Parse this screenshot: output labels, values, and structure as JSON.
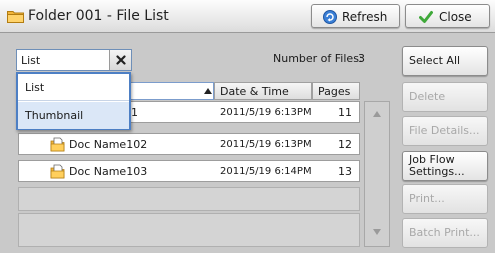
{
  "window": {
    "title": "Folder 001 - File List"
  },
  "toolbar": {
    "refresh_label": "Refresh",
    "close_label": "Close"
  },
  "view_select": {
    "selected": "List",
    "options": [
      "List",
      "Thumbnail"
    ]
  },
  "file_count": {
    "label": "Number of Files:",
    "value": "3"
  },
  "table": {
    "columns": [
      "Date & Time",
      "Pages"
    ],
    "rows": [
      {
        "name": "1",
        "date": "2011/5/19 6:13PM",
        "pages": "11"
      },
      {
        "name": "Doc Name102",
        "date": "2011/5/19 6:13PM",
        "pages": "12"
      },
      {
        "name": "Doc Name103",
        "date": "2011/5/19 6:14PM",
        "pages": "13"
      }
    ]
  },
  "actions": {
    "select_all": "Select All",
    "delete": "Delete",
    "file_details": "File Details...",
    "job_flow_line1": "Job Flow",
    "job_flow_line2": "Settings...",
    "print": "Print...",
    "batch_print": "Batch Print..."
  },
  "colors": {
    "title_bar": "#e9e9e9",
    "panel_background": "#c9c9c9",
    "dropdown_border": "#4d7fc4",
    "dropdown_highlight": "#dbe7f7",
    "disabled_text": "#a8a8a8"
  },
  "icons": {
    "folder": "folder-icon",
    "refresh": "refresh-icon",
    "close": "checkmark-icon",
    "clear": "close-x-icon",
    "document": "document-icon",
    "sort": "sort-up-icon",
    "scroll_up": "scroll-up-icon",
    "scroll_down": "scroll-down-icon"
  }
}
